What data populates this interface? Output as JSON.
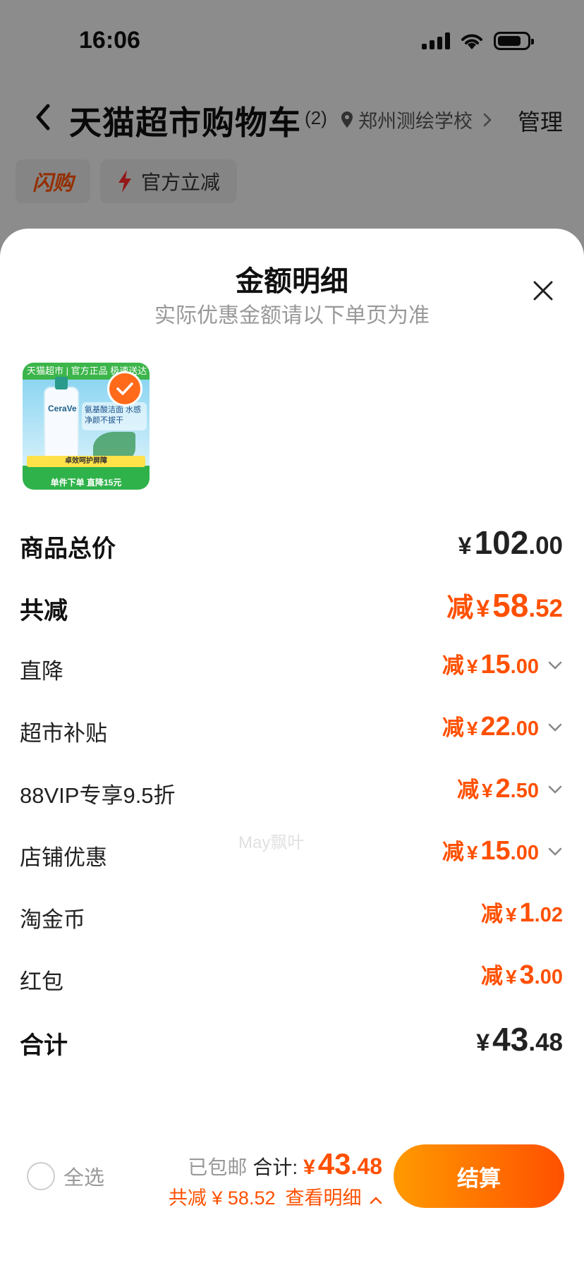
{
  "status_bar": {
    "time": "16:06"
  },
  "nav": {
    "title": "天猫超市购物车",
    "count": "(2)",
    "location": "郑州测绘学校",
    "manage": "管理"
  },
  "chips": {
    "flash": "闪购",
    "official": "官方立减"
  },
  "sheet": {
    "title": "金额明细",
    "subtitle": "实际优惠金额请以下单页为准"
  },
  "product": {
    "banner": "天猫超市 | 官方正品 极速送达",
    "brand": "CeraVe",
    "tag": "氨基酸洁面 水感净颜不拔干",
    "footer_top": "卓效呵护屏障",
    "footer": "单件下单 直降15元"
  },
  "rows": [
    {
      "label": "商品总价",
      "minus": "",
      "yen": "¥",
      "int": "102",
      "dec": ".00"
    },
    {
      "label": "共减",
      "minus": "减",
      "yen": "¥",
      "int": "58",
      "dec": ".52"
    },
    {
      "label": "直降",
      "minus": "减",
      "yen": "¥",
      "int": "15",
      "dec": ".00"
    },
    {
      "label": "超市补贴",
      "minus": "减",
      "yen": "¥",
      "int": "22",
      "dec": ".00"
    },
    {
      "label": "88VIP专享9.5折",
      "minus": "减",
      "yen": "¥",
      "int": "2",
      "dec": ".50"
    },
    {
      "label": "店铺优惠",
      "minus": "减",
      "yen": "¥",
      "int": "15",
      "dec": ".00"
    },
    {
      "label": "淘金币",
      "minus": "减",
      "yen": "¥",
      "int": "1",
      "dec": ".02"
    },
    {
      "label": "红包",
      "minus": "减",
      "yen": "¥",
      "int": "3",
      "dec": ".00"
    },
    {
      "label": "合计",
      "minus": "",
      "yen": "¥",
      "int": "43",
      "dec": ".48"
    }
  ],
  "watermark": "May飘叶",
  "footer": {
    "select_all": "全选",
    "free_shipping": "已包邮",
    "total_label": "合计:",
    "total_yen": "¥",
    "total_int": "43",
    "total_dec": ".48",
    "discount": "共减 ¥ 58.52",
    "detail_link": "查看明细",
    "checkout": "结算"
  },
  "colors": {
    "accent": "#ff5000",
    "gradient_start": "#ff9a00",
    "gradient_end": "#ff5000"
  }
}
